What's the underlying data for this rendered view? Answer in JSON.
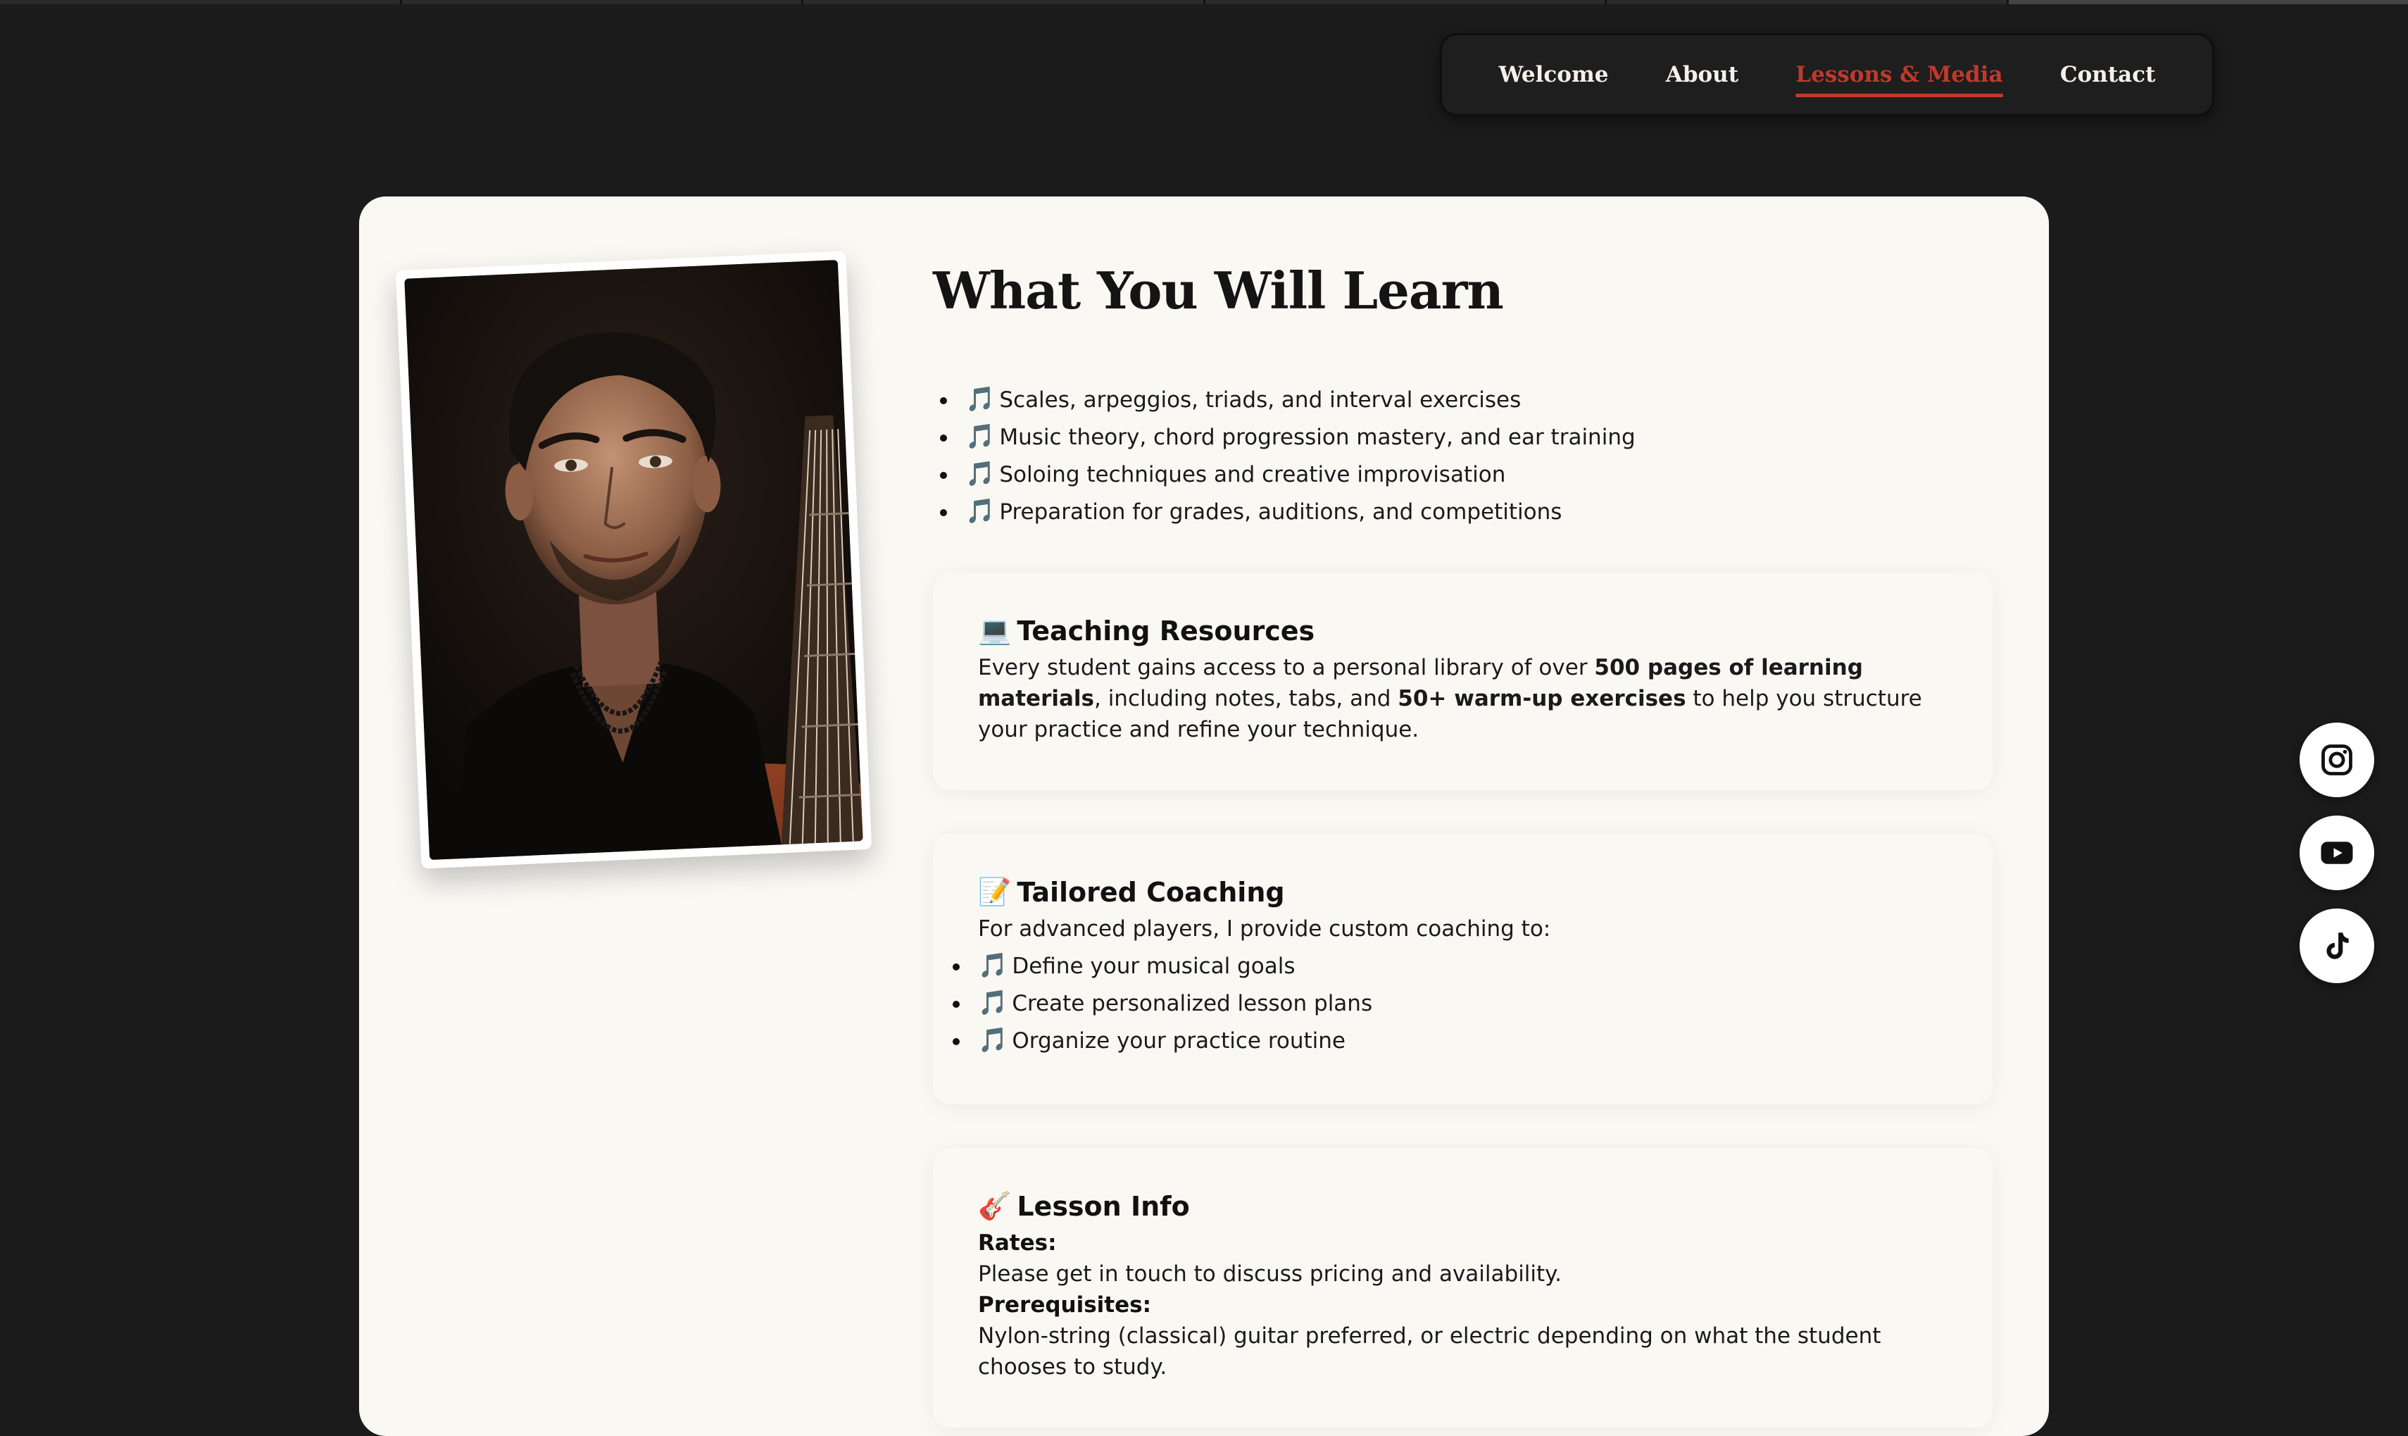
{
  "nav": {
    "items": [
      {
        "label": "Welcome",
        "active": false
      },
      {
        "label": "About",
        "active": false
      },
      {
        "label": "Lessons & Media",
        "active": true
      },
      {
        "label": "Contact",
        "active": false
      }
    ],
    "accent_color": "#c0392b"
  },
  "main": {
    "heading": "What You Will Learn",
    "learn_items": [
      "Scales, arpeggios, triads, and interval exercises",
      "Music theory, chord progression mastery, and ear training",
      "Soloing techniques and creative improvisation",
      "Preparation for grades, auditions, and competitions"
    ],
    "bullet_icon": "🎵",
    "teaching": {
      "icon": "💻",
      "title": "Teaching Resources",
      "text_1": "Every student gains access to a personal library of over ",
      "bold_1": "500 pages of learning materials",
      "text_2": ", including notes, tabs, and ",
      "bold_2": "50+ warm-up exercises",
      "text_3": " to help you structure your practice and refine your technique."
    },
    "coaching": {
      "icon": "📝",
      "title": "Tailored Coaching",
      "intro": "For advanced players, I provide custom coaching to:",
      "items": [
        "Define your musical goals",
        "Create personalized lesson plans",
        "Organize your practice routine"
      ]
    },
    "lesson_info": {
      "icon": "🎸",
      "title": "Lesson Info",
      "rates_label": "Rates:",
      "rates_text": "Please get in touch to discuss pricing and availability.",
      "prereq_label": "Prerequisites:",
      "prereq_text": "Nylon-string (classical) guitar preferred, or electric depending on what the student chooses to study."
    }
  },
  "social": [
    "instagram-icon",
    "youtube-icon",
    "tiktok-icon"
  ],
  "colors": {
    "page_bg": "#1b1b1b",
    "card_bg": "#faf8f3",
    "accent": "#c0392b"
  }
}
